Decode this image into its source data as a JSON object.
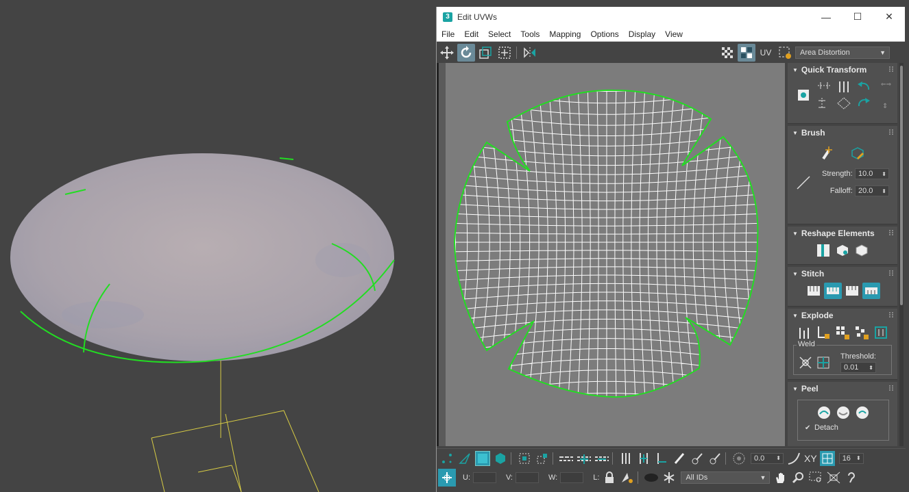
{
  "window": {
    "title": "Edit UVWs",
    "app_icon": "3",
    "minimize": "—",
    "maximize": "☐",
    "close": "✕"
  },
  "menu": [
    "File",
    "Edit",
    "Select",
    "Tools",
    "Mapping",
    "Options",
    "Display",
    "View"
  ],
  "toolbar": {
    "uv_label": "UV",
    "display_mode": "Area Distortion"
  },
  "rollouts": {
    "quick_transform": "Quick Transform",
    "brush": "Brush",
    "strength_label": "Strength:",
    "strength_value": "10.0",
    "falloff_label": "Falloff:",
    "falloff_value": "20.0",
    "reshape": "Reshape Elements",
    "stitch": "Stitch",
    "explode": "Explode",
    "weld": "Weld",
    "threshold_label": "Threshold:",
    "threshold_value": "0.01",
    "peel": "Peel",
    "detach": "Detach"
  },
  "bottom": {
    "angle_value": "0.0",
    "xy_label": "XY",
    "grid_value": "16",
    "u_label": "U:",
    "v_label": "V:",
    "w_label": "W:",
    "l_label": "L:",
    "ids_value": "All IDs"
  },
  "colors": {
    "accent": "#1aa3a3",
    "seam": "#22dd22",
    "uv_bg": "#7c7c7c",
    "gizmo": "#e0d040"
  }
}
